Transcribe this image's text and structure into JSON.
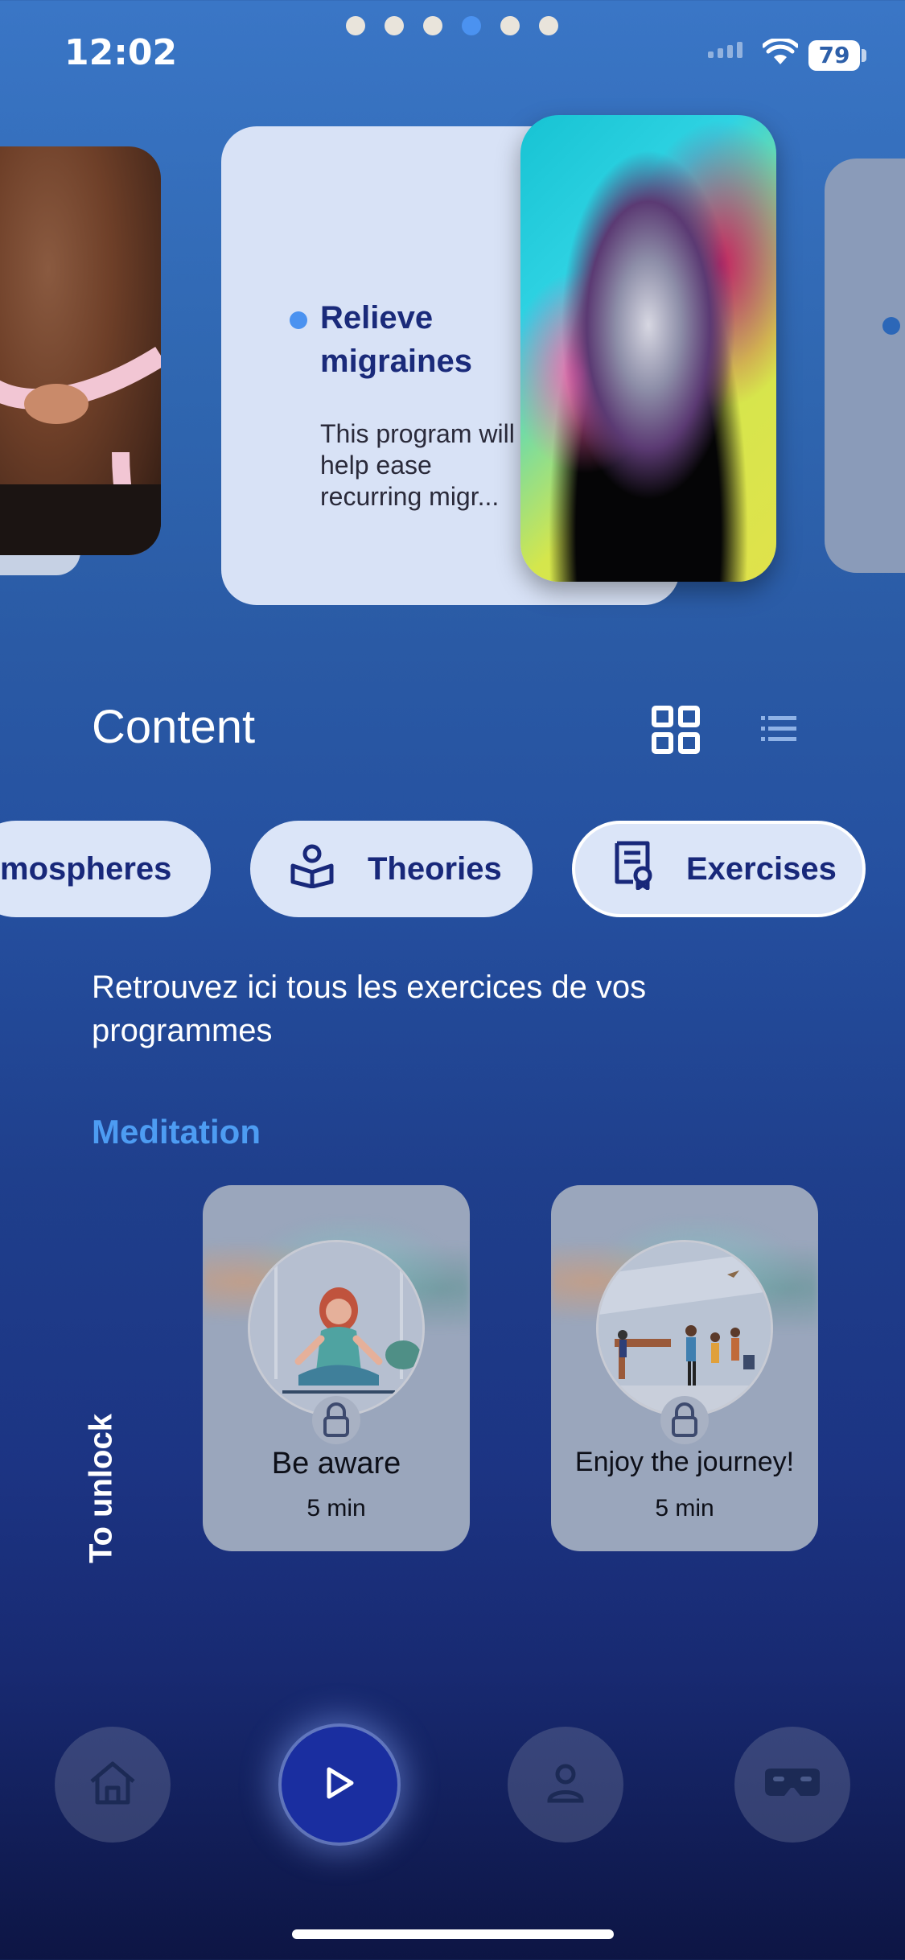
{
  "status_bar": {
    "time": "12:02",
    "battery": "79"
  },
  "carousel": {
    "pages": 6,
    "active_page": 4,
    "current_card": {
      "title": "Relieve migraines",
      "description": "This program will help ease recurring migr..."
    }
  },
  "content": {
    "title": "Content",
    "view_grid_icon": "grid-view-icon",
    "view_list_icon": "list-view-icon"
  },
  "chips": [
    {
      "label": "mospheres"
    },
    {
      "label": "Theories",
      "icon": "theories-icon"
    },
    {
      "label": "Exercises",
      "icon": "exercises-icon",
      "selected": true
    }
  ],
  "description": "Retrouvez ici tous les exercices de vos programmes",
  "section": {
    "title": "Meditation",
    "side_label": "To unlock",
    "items": [
      {
        "title": "Be aware",
        "duration": "5 min",
        "locked": true
      },
      {
        "title": "Enjoy the journey!",
        "duration": "5 min",
        "locked": true
      }
    ]
  },
  "nav": {
    "items": [
      {
        "icon": "home-icon"
      },
      {
        "icon": "play-icon",
        "active": true
      },
      {
        "icon": "profile-icon"
      },
      {
        "icon": "vr-headset-icon"
      }
    ]
  },
  "colors": {
    "accent": "#4b92f0",
    "chip_bg": "#dbe5f8",
    "chip_text": "#18287a",
    "nav_active": "#1a2ea0"
  }
}
